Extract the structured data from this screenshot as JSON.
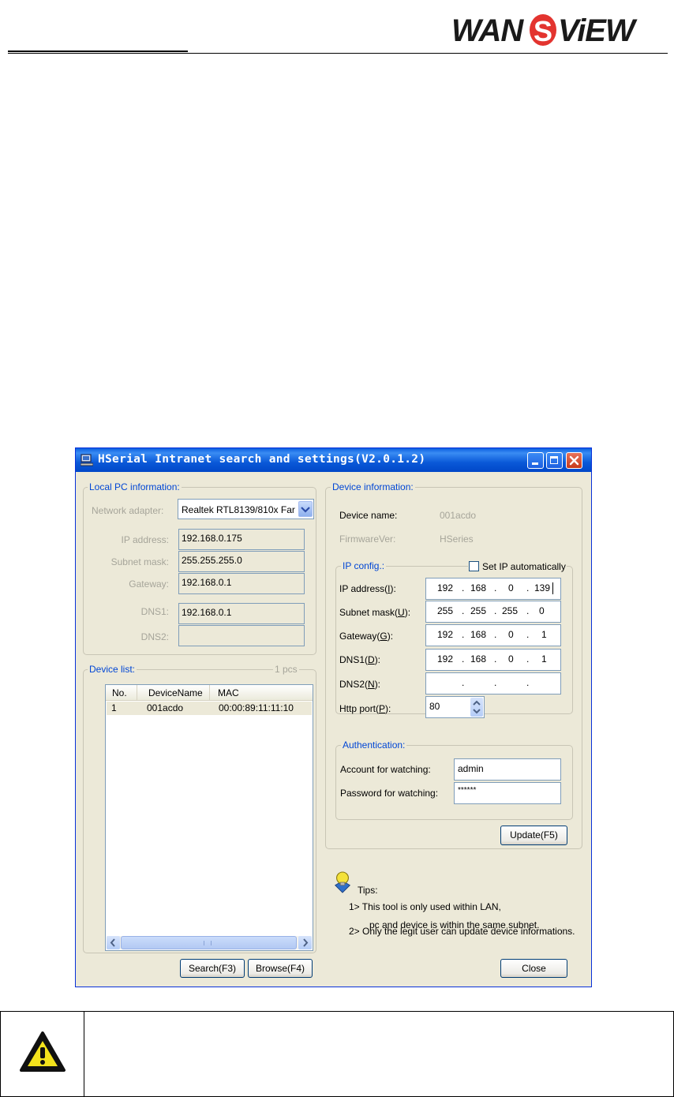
{
  "brand": {
    "logo_text": "WANSVIEW"
  },
  "window": {
    "title": "HSerial Intranet search and settings(V2.0.1.2)",
    "local_pc": {
      "title": "Local PC information:",
      "network_adapter_label": "Network adapter:",
      "network_adapter_value": "Realtek RTL8139/810x Far",
      "ip_label": "IP address:",
      "ip_value": "192.168.0.175",
      "subnet_label": "Subnet mask:",
      "subnet_value": "255.255.255.0",
      "gateway_label": "Gateway:",
      "gateway_value": "192.168.0.1",
      "dns1_label": "DNS1:",
      "dns1_value": "192.168.0.1",
      "dns2_label": "DNS2:",
      "dns2_value": ""
    },
    "device_list": {
      "title": "Device list:",
      "count": "1 pcs",
      "columns": [
        "No.",
        "DeviceName",
        "MAC"
      ],
      "rows": [
        [
          "1",
          "001acdo",
          "00:00:89:11:11:10"
        ]
      ]
    },
    "device_info": {
      "title": "Device information:",
      "name_label": "Device name:",
      "name_value": "001acdo",
      "firmware_label": "FirmwareVer:",
      "firmware_value": "HSeries"
    },
    "ip_config": {
      "title": "IP config.:",
      "auto_label": "Set IP automatically",
      "auto_checked": false,
      "ip_label": "IP address(I):",
      "ip": [
        "192",
        "168",
        "0",
        "139"
      ],
      "subnet_label": "Subnet mask(U):",
      "subnet": [
        "255",
        "255",
        "255",
        "0"
      ],
      "gateway_label": "Gateway(G):",
      "gateway": [
        "192",
        "168",
        "0",
        "1"
      ],
      "dns1_label": "DNS1(D):",
      "dns1": [
        "192",
        "168",
        "0",
        "1"
      ],
      "dns2_label": "DNS2(N):",
      "dns2": [
        "",
        "",
        "",
        ""
      ],
      "dot": ".",
      "port_label": "Http port(P):",
      "port_value": "80"
    },
    "auth": {
      "title": "Authentication:",
      "account_label": "Account for watching:",
      "account_value": "admin",
      "password_label": "Password for watching:",
      "password_value": "******"
    },
    "buttons": {
      "update": "Update(F5)",
      "search": "Search(F3)",
      "browse": "Browse(F4)",
      "close": "Close"
    },
    "tips": {
      "title": "Tips:",
      "line1": "1> This tool is only used within LAN,",
      "line2": "pc and device is within the same subnet.",
      "line3": "2> Only the legit user can update  device informations."
    }
  },
  "colors": {
    "titlebar": "#0a5ee0",
    "group_title": "#0046d5",
    "window_bg": "#ece9d8"
  }
}
